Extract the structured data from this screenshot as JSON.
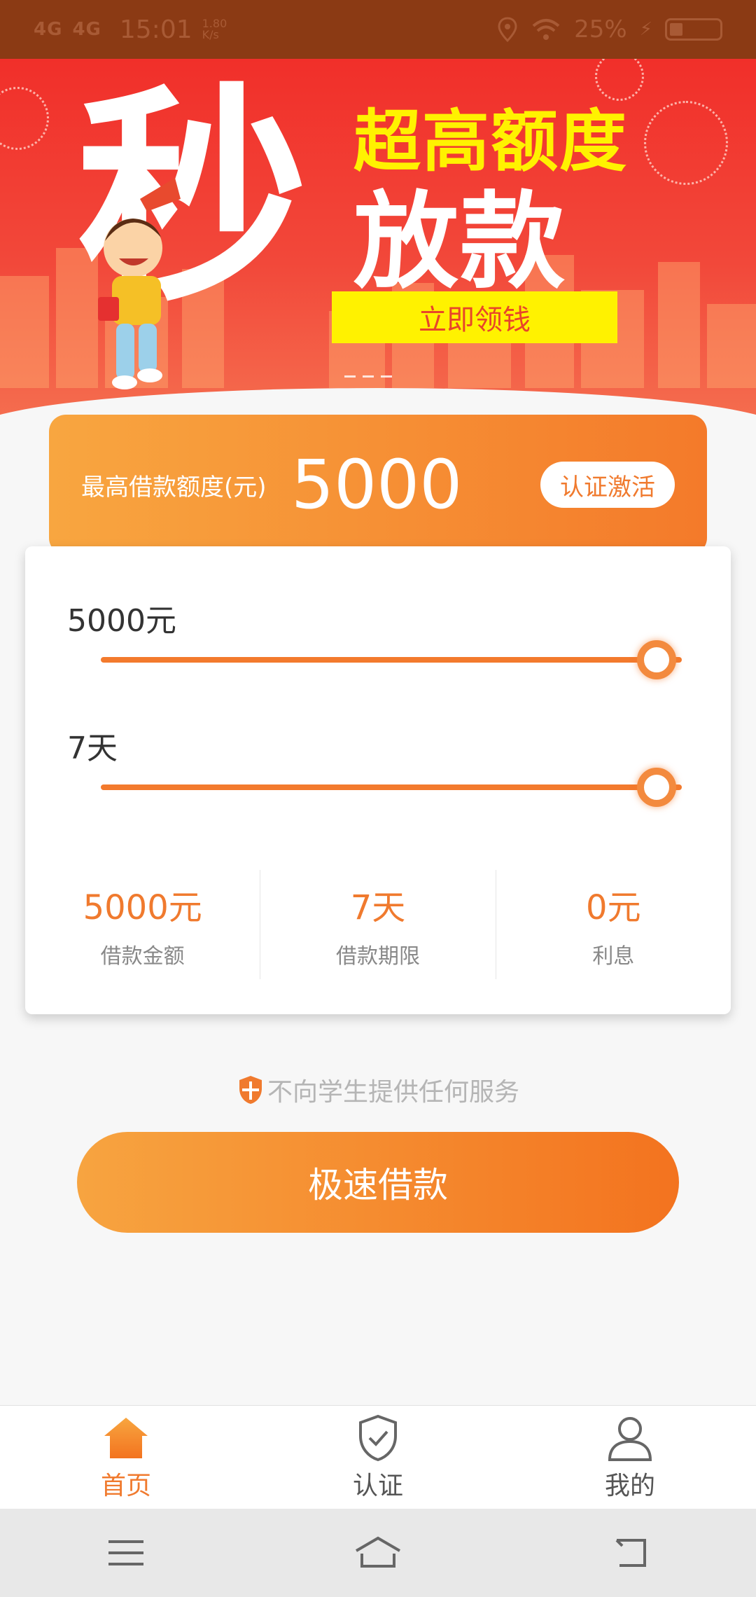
{
  "status_bar": {
    "signal1": "4G",
    "signal2": "4G",
    "time": "15:01",
    "speed": "1.80 K/s",
    "battery": "25%"
  },
  "banner": {
    "big_char": "秒",
    "slogan_top": "超高额度",
    "slogan_main": "放款",
    "cta_label": "立即领钱"
  },
  "quota": {
    "label": "最高借款额度(元)",
    "value": "5000",
    "activate_label": "认证激活"
  },
  "sliders": {
    "amount": {
      "label": "5000元",
      "level": 1.0
    },
    "term": {
      "label": "7天",
      "level": 1.0
    }
  },
  "summary": [
    {
      "value": "5000元",
      "label": "借款金额"
    },
    {
      "value": "7天",
      "label": "借款期限"
    },
    {
      "value": "0元",
      "label": "利息"
    }
  ],
  "notice": "不向学生提供任何服务",
  "loan_button": "极速借款",
  "tabs": [
    {
      "label": "首页",
      "icon": "home-icon",
      "active": true
    },
    {
      "label": "认证",
      "icon": "shield-check-icon",
      "active": false
    },
    {
      "label": "我的",
      "icon": "user-icon",
      "active": false
    }
  ],
  "colors": {
    "accent": "#f07a2e",
    "banner_red": "#f12f2a",
    "cta_yellow": "#fff200"
  }
}
